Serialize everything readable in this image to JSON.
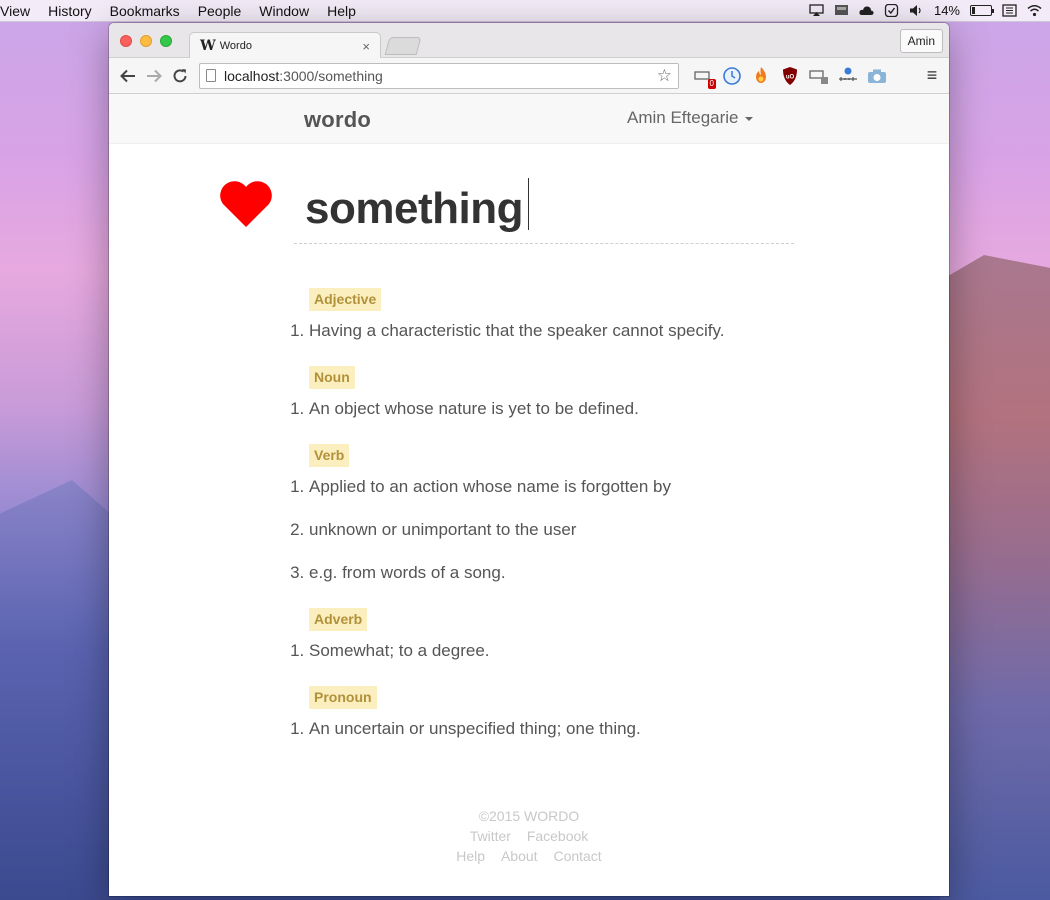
{
  "menubar": {
    "items": [
      "View",
      "History",
      "Bookmarks",
      "People",
      "Window",
      "Help"
    ],
    "battery_percent": "14%"
  },
  "browser": {
    "tab_title": "Wordo",
    "tab_favicon": "W",
    "tab_close": "×",
    "profile_label": "Amin",
    "url_host": "localhost",
    "url_rest": ":3000/something",
    "extension_badge": "0"
  },
  "site": {
    "brand": "wordo",
    "user_name": "Amin Eftegarie",
    "word": "something",
    "heart_color": "#ff0000",
    "sections": [
      {
        "pos": "Adjective",
        "defs": [
          "Having a characteristic that the speaker cannot specify."
        ]
      },
      {
        "pos": "Noun",
        "defs": [
          "An object whose nature is yet to be defined."
        ]
      },
      {
        "pos": "Verb",
        "defs": [
          "Applied to an action whose name is forgotten by",
          "unknown or unimportant to the user",
          "e.g. from words of a song."
        ]
      },
      {
        "pos": "Adverb",
        "defs": [
          "Somewhat; to a degree."
        ]
      },
      {
        "pos": "Pronoun",
        "defs": [
          "An uncertain or unspecified thing; one thing."
        ]
      }
    ],
    "footer": {
      "copyright": "©2015 WORDO",
      "row1": [
        "Twitter",
        "Facebook"
      ],
      "row2": [
        "Help",
        "About",
        "Contact"
      ]
    }
  }
}
